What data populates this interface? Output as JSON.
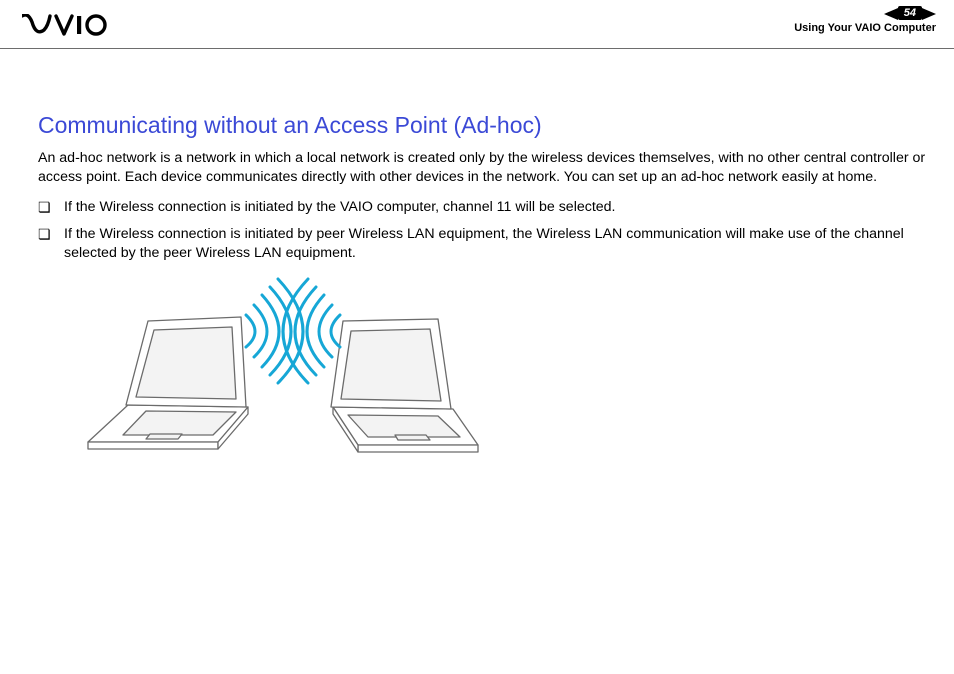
{
  "header": {
    "logo_alt": "VAIO",
    "page_number": "54",
    "section": "Using Your VAIO Computer"
  },
  "body": {
    "title": "Communicating without an Access Point (Ad-hoc)",
    "intro": "An ad-hoc network is a network in which a local network is created only by the wireless devices themselves, with no other central controller or access point. Each device communicates directly with other devices in the network. You can set up an ad-hoc network easily at home.",
    "bullets": [
      "If the Wireless connection is initiated by the VAIO computer, channel 11 will be selected.",
      "If the Wireless connection is initiated by peer Wireless LAN equipment, the Wireless LAN communication will make use of the channel selected by the peer Wireless LAN equipment."
    ]
  },
  "figure": {
    "alt": "Two laptops communicating wirelessly (ad-hoc)"
  }
}
